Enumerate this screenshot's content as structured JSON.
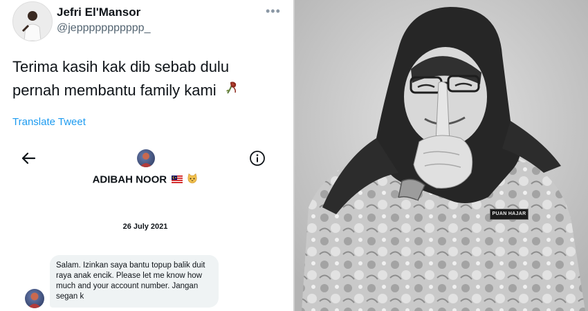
{
  "tweet": {
    "author_name": "Jefri El'Mansor",
    "author_handle": "@jeppppppppppp_",
    "more_icon": "more-horizontal-icon",
    "text": "Terima kasih kak dib sebab dulu pernah membantu family kami",
    "emoji_icon": "wilted-rose-icon",
    "translate_label": "Translate Tweet"
  },
  "dm": {
    "contact_name": "ADIBAH NOOR",
    "flag_icon": "malaysia-flag-icon",
    "cat_icon": "cat-face-icon",
    "date": "26 July 2021",
    "message": "Salam. Izinkan saya bantu topup balik duit raya anak encik. Please let me know how much and your account number. Jangan segan k"
  },
  "photo": {
    "nameplate": "PUAN HAJAR"
  },
  "colors": {
    "link": "#1d9bf0",
    "text": "#0f1419",
    "muted": "#536471",
    "bubble": "#eff3f4"
  }
}
